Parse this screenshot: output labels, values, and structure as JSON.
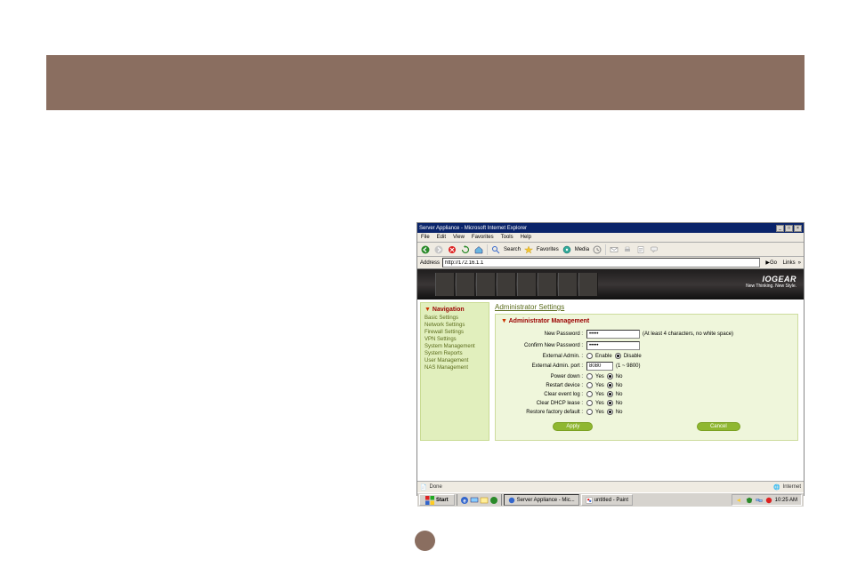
{
  "browser": {
    "title": "Server Appliance - Microsoft Internet Explorer",
    "menu": {
      "file": "File",
      "edit": "Edit",
      "view": "View",
      "favorites": "Favorites",
      "tools": "Tools",
      "help": "Help"
    },
    "toolbar": {
      "search": "Search",
      "favorites": "Favorites",
      "media": "Media"
    },
    "address": {
      "label": "Address",
      "url": "http://172.16.1.1",
      "go": "Go",
      "links": "Links"
    },
    "status": {
      "done": "Done",
      "zone": "Internet"
    }
  },
  "hero": {
    "brand": "IOGEAR",
    "tag": "New Thinking. New Style."
  },
  "nav": {
    "title": "Navigation",
    "items": [
      "Basic Settings",
      "Network Settings",
      "Firewall Settings",
      "VPN Settings",
      "System Management",
      "System Reports",
      "User Management",
      "NAS Management"
    ]
  },
  "main": {
    "title": "Administrator Settings",
    "section": "Administrator Management",
    "labels": {
      "newpw": "New Password :",
      "confirmpw": "Confirm New Password :",
      "extadmin": "External Admin. :",
      "extport": "External Admin. port :",
      "powerdown": "Power down :",
      "restart": "Restart device :",
      "clearlog": "Clear event log :",
      "cleardhcp": "Clear DHCP lease :",
      "factory": "Restore factory default :"
    },
    "hints": {
      "pw": "(At least 4 characters, no white space)",
      "port": "(1 ~ 9800)"
    },
    "values": {
      "newpw": "*****",
      "confirmpw": "*****",
      "port": "8080"
    },
    "options": {
      "enable": "Enable",
      "disable": "Disable",
      "yes": "Yes",
      "no": "No"
    },
    "buttons": {
      "apply": "Apply",
      "cancel": "Cancel"
    }
  },
  "taskbar": {
    "start": "Start",
    "tasks": [
      "Server Appliance - Mic...",
      "untitled - Paint"
    ],
    "time": "10:25 AM"
  }
}
